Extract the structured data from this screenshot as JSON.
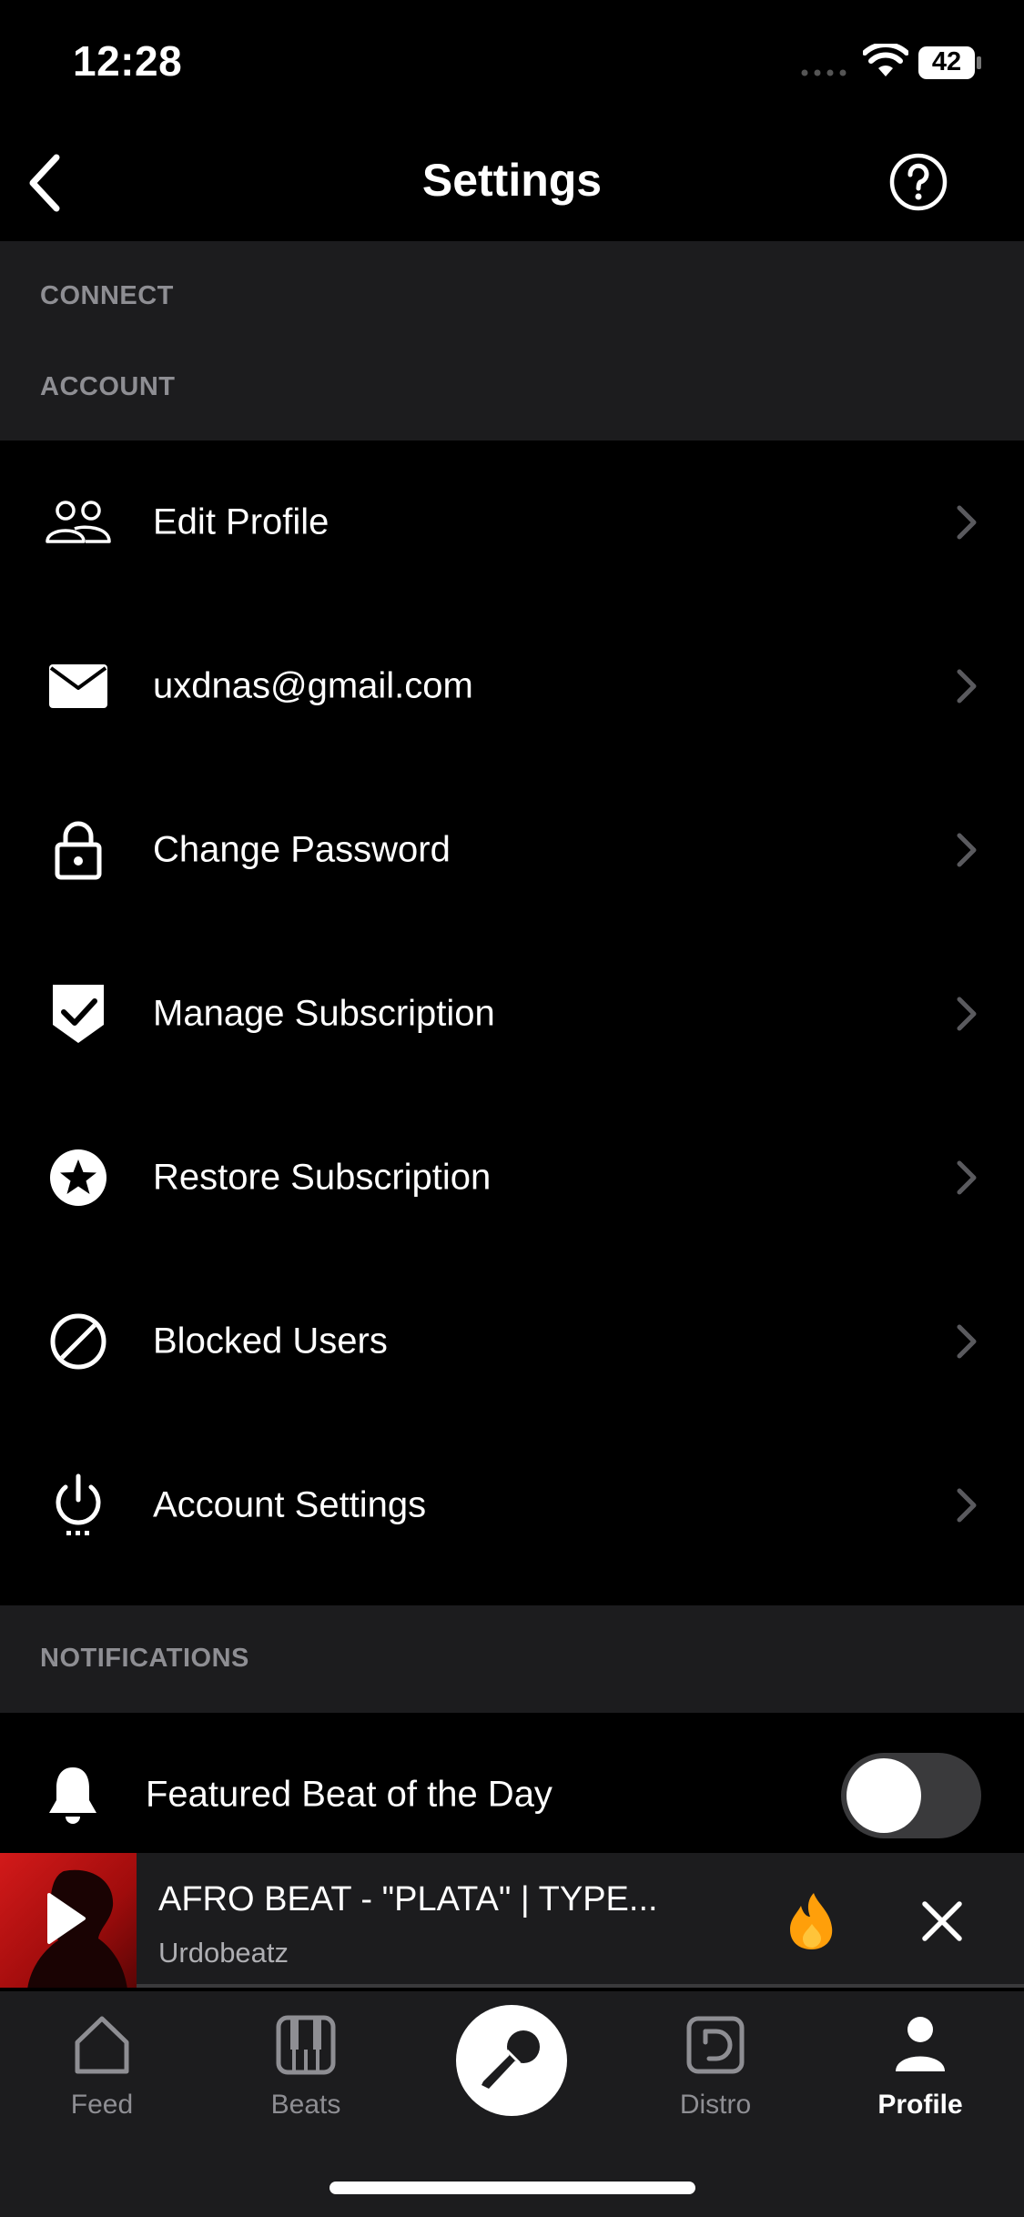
{
  "status_bar": {
    "time": "12:28",
    "battery": "42"
  },
  "nav": {
    "title": "Settings"
  },
  "sections": {
    "connect": "CONNECT",
    "account": "ACCOUNT",
    "notifications": "NOTIFICATIONS"
  },
  "account_items": [
    {
      "label": "Edit Profile",
      "icon": "users-icon"
    },
    {
      "label": "uxdnas@gmail.com",
      "icon": "mail-icon"
    },
    {
      "label": "Change Password",
      "icon": "lock-icon"
    },
    {
      "label": "Manage Subscription",
      "icon": "shield-check-icon"
    },
    {
      "label": "Restore Subscription",
      "icon": "star-icon"
    },
    {
      "label": "Blocked Users",
      "icon": "block-icon"
    },
    {
      "label": "Account Settings",
      "icon": "power-icon"
    }
  ],
  "notifications": {
    "featured_beat_label": "Featured Beat of the Day",
    "featured_beat_enabled": false
  },
  "player": {
    "title": "AFRO BEAT - \"PLATA\" | TYPE...",
    "artist": "Urdobeatz"
  },
  "tabs": [
    {
      "label": "Feed",
      "icon": "home-icon",
      "active": false
    },
    {
      "label": "Beats",
      "icon": "piano-icon",
      "active": false
    },
    {
      "label": "Distro",
      "icon": "distro-icon",
      "active": false
    },
    {
      "label": "Profile",
      "icon": "profile-icon",
      "active": true
    }
  ],
  "colors": {
    "background": "#000000",
    "section_bg": "#1c1c1e",
    "muted": "#8e8e93",
    "accent_fire": "#ff9f0a"
  }
}
